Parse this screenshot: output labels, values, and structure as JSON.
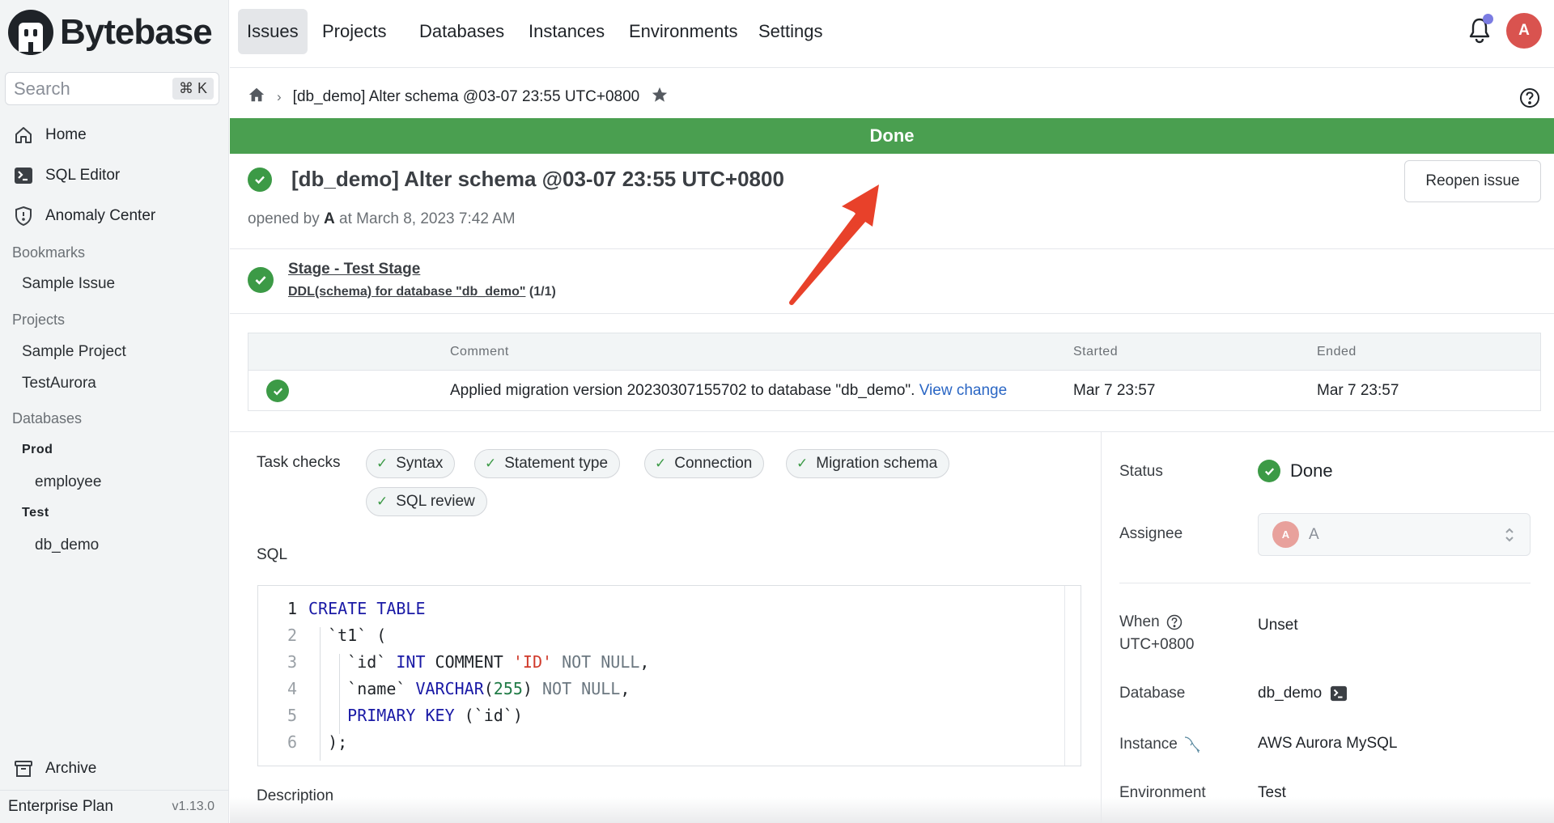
{
  "app": {
    "name": "Bytebase"
  },
  "sidebar": {
    "search_placeholder": "Search",
    "search_shortcut": "⌘ K",
    "nav": [
      {
        "label": "Home",
        "icon": "home-icon"
      },
      {
        "label": "SQL Editor",
        "icon": "terminal-icon"
      },
      {
        "label": "Anomaly Center",
        "icon": "shield-alert-icon"
      }
    ],
    "bookmarks": {
      "label": "Bookmarks",
      "items": [
        "Sample Issue"
      ]
    },
    "projects": {
      "label": "Projects",
      "items": [
        "Sample Project",
        "TestAurora"
      ]
    },
    "databases": {
      "label": "Databases",
      "groups": [
        {
          "env": "Prod",
          "items": [
            "employee"
          ]
        },
        {
          "env": "Test",
          "items": [
            "db_demo"
          ]
        }
      ]
    },
    "archive": "Archive",
    "plan": "Enterprise Plan",
    "version": "v1.13.0"
  },
  "topnav": {
    "tabs": [
      "Issues",
      "Projects",
      "Databases",
      "Instances",
      "Environments",
      "Settings"
    ],
    "active_tab": "Issues",
    "avatar_initial": "A",
    "notification_dot_color": "#7b7ce2"
  },
  "breadcrumb": {
    "current": "[db_demo] Alter schema @03-07 23:55 UTC+0800"
  },
  "status_bar": {
    "label": "Done",
    "color": "#4a9f50"
  },
  "issue": {
    "title": "[db_demo] Alter schema @03-07 23:55 UTC+0800",
    "opened_prefix": "opened by ",
    "opened_by": "A",
    "opened_suffix": " at March 8, 2023 7:42 AM",
    "reopen_label": "Reopen issue"
  },
  "stage": {
    "title": "Stage - Test Stage",
    "task_link": "DDL(schema) for database \"db_demo\"",
    "task_count": "(1/1)"
  },
  "task_runs": {
    "columns": [
      "Comment",
      "Started",
      "Ended"
    ],
    "rows": [
      {
        "status": "done",
        "comment": "Applied migration version 20230307155702 to database \"db_demo\".",
        "link": "View change",
        "started": "Mar 7 23:57",
        "ended": "Mar 7 23:57"
      }
    ]
  },
  "task_checks": {
    "label": "Task checks",
    "items": [
      "Syntax",
      "Statement type",
      "Connection",
      "Migration schema",
      "SQL review"
    ]
  },
  "sql": {
    "label": "SQL",
    "lines": [
      "CREATE TABLE",
      "  `t1` (",
      "    `id` INT COMMENT 'ID' NOT NULL,",
      "    `name` VARCHAR(255) NOT NULL,",
      "    PRIMARY KEY (`id`)",
      "  );"
    ]
  },
  "description_label": "Description",
  "details": {
    "status_label": "Status",
    "status_value": "Done",
    "assignee_label": "Assignee",
    "assignee_initial": "A",
    "assignee_name": "A",
    "when_label": "When",
    "when_tz": "UTC+0800",
    "when_value": "Unset",
    "database_label": "Database",
    "database_value": "db_demo",
    "instance_label": "Instance",
    "instance_value": "AWS Aurora MySQL",
    "environment_label": "Environment",
    "environment_value": "Test"
  },
  "annotation": {
    "type": "arrow",
    "color": "#e8412a"
  }
}
